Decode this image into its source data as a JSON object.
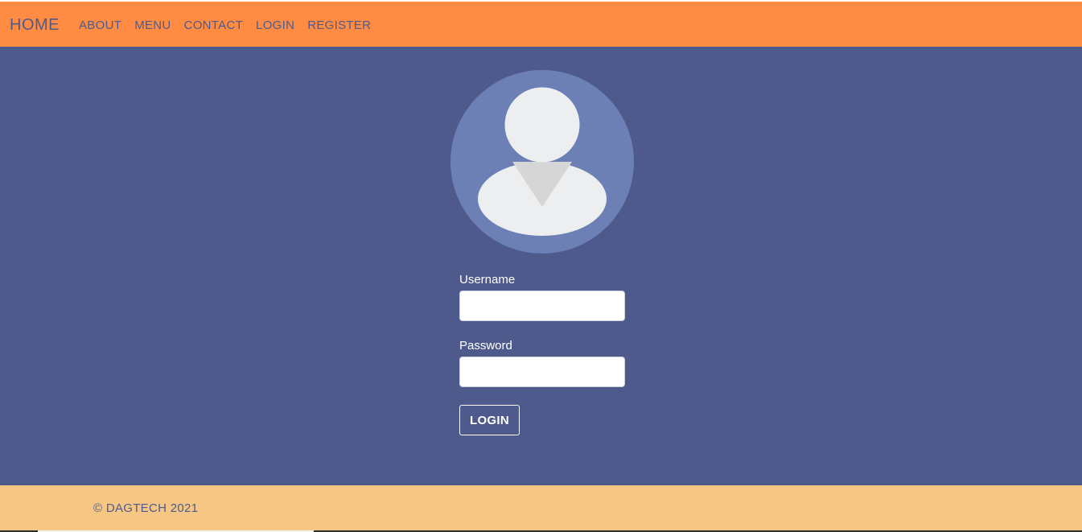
{
  "navbar": {
    "brand": "HOME",
    "links": [
      "ABOUT",
      "MENU",
      "CONTACT",
      "LOGIN",
      "REGISTER"
    ],
    "background": "#ff8c42",
    "text_color": "#4e5a8c"
  },
  "main": {
    "background": "#4e5a8c",
    "avatar_icon": "user-avatar-icon",
    "form": {
      "username_label": "Username",
      "username_value": "",
      "password_label": "Password",
      "password_value": "",
      "submit_label": "LOGIN"
    }
  },
  "footer": {
    "text": "© DAGTECH 2021",
    "background": "#f6c684"
  }
}
